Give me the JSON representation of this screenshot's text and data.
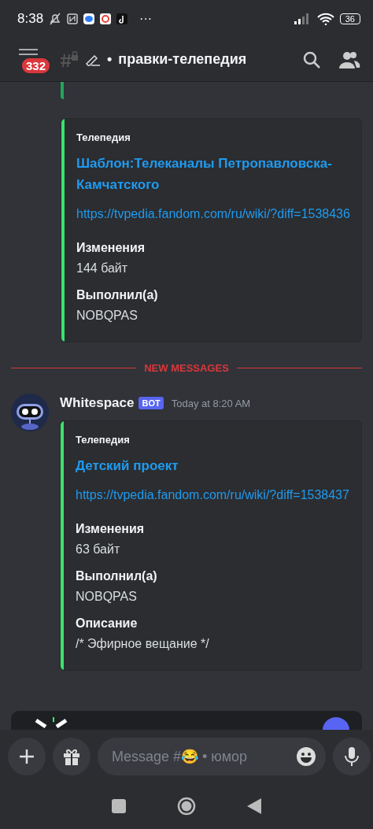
{
  "status_bar": {
    "time": "8:38",
    "more": "···",
    "battery": "36"
  },
  "header": {
    "unread_badge": "332",
    "separator": "•",
    "channel": "правки-телепедия"
  },
  "embeds_before": [
    {
      "source": "Телепедия",
      "title": "Шаблон:Телеканалы Петропавловска-Камчатского",
      "url": "https://tvpedia.fandom.com/ru/wiki/?diff=1538436",
      "fields": [
        {
          "name": "Изменения",
          "value": "144 байт"
        },
        {
          "name": "Выполнил(а)",
          "value": "NOBQPAS"
        }
      ]
    }
  ],
  "divider": "NEW MESSAGES",
  "message": {
    "author": "Whitespace",
    "tag": "BOT",
    "time": "Today at 8:20 AM",
    "embeds": [
      {
        "source": "Телепедия",
        "title": "Детский проект",
        "url": "https://tvpedia.fandom.com/ru/wiki/?diff=1538437",
        "fields": [
          {
            "name": "Изменения",
            "value": "63 байт"
          },
          {
            "name": "Выполнил(а)",
            "value": "NOBQPAS"
          },
          {
            "name": "Описание",
            "value": "/* Эфирное вещание */"
          }
        ]
      }
    ]
  },
  "composer": {
    "placeholder": "Message #😂 • юмор"
  }
}
